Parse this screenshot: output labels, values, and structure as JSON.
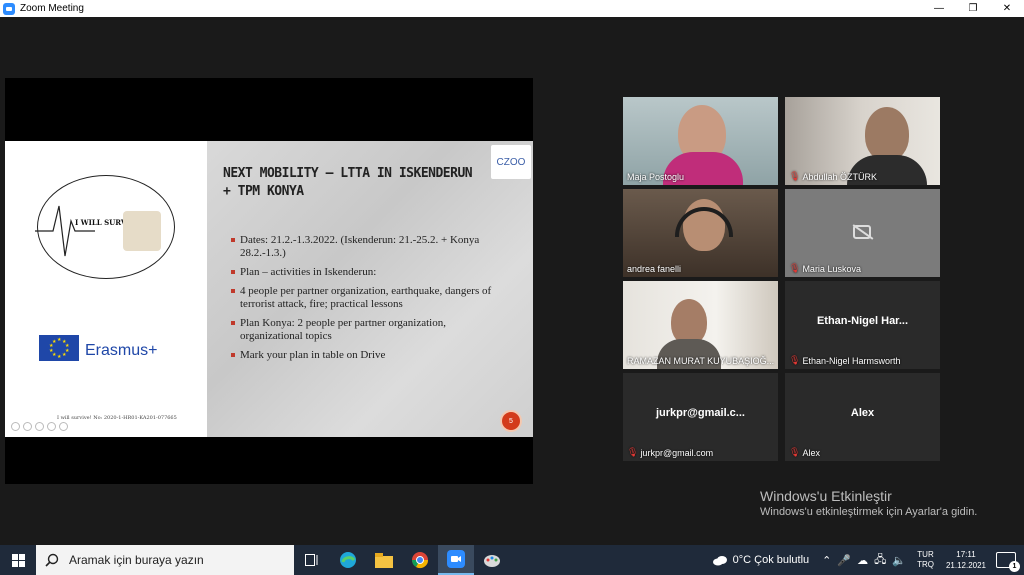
{
  "window": {
    "title": "Zoom Meeting",
    "min": "—",
    "max": "❐",
    "close": "✕"
  },
  "slide": {
    "title": "NEXT MOBILITY – LTTA IN ISKENDERUN + TPM KONYA",
    "logo_text": "I WILL SURVIVE!",
    "erasmus": "Erasmus+",
    "czoo": "CZOO",
    "project_line": "I will survive! No: 2020-1-HR01-KA201-077665",
    "page_number": "5",
    "bullets": [
      "Dates: 21.2.-1.3.2022. (Iskenderun: 21.-25.2. + Konya 28.2.-1.3.)",
      "Plan – activities in Iskenderun:",
      "4 people per partner organization, earthquake, dangers of terrorist attack, fire; practical lessons",
      "Plan Konya: 2 people per partner organization, organizational topics",
      "Mark your plan in table on Drive"
    ]
  },
  "participants": [
    {
      "name": "Maja Postoglu",
      "muted": false,
      "video": true,
      "active": true
    },
    {
      "name": "Abdullah ÖZTÜRK",
      "muted": true,
      "video": true
    },
    {
      "name": "andrea fanelli",
      "muted": false,
      "video": true
    },
    {
      "name": "Maria Luskova",
      "muted": true,
      "video": false
    },
    {
      "name": "RAMAZAN MURAT KUYUBAŞIOĞ...",
      "muted": false,
      "video": true
    },
    {
      "name": "Ethan-Nigel Harmsworth",
      "display": "Ethan-Nigel Har...",
      "muted": true,
      "video": false
    },
    {
      "name": "jurkpr@gmail.com",
      "display": "jurkpr@gmail.c...",
      "muted": true,
      "video": false
    },
    {
      "name": "Alex",
      "display": "Alex",
      "muted": true,
      "video": false
    }
  ],
  "activation": {
    "heading": "Windows'u Etkinleştir",
    "sub": "Windows'u etkinleştirmek için Ayarlar'a gidin."
  },
  "taskbar": {
    "search_placeholder": "Aramak için buraya yazın",
    "weather": "0°C  Çok bulutlu",
    "lang_top": "TUR",
    "lang_bottom": "TRQ",
    "time": "17:11",
    "date": "21.12.2021",
    "notifications": "1"
  }
}
